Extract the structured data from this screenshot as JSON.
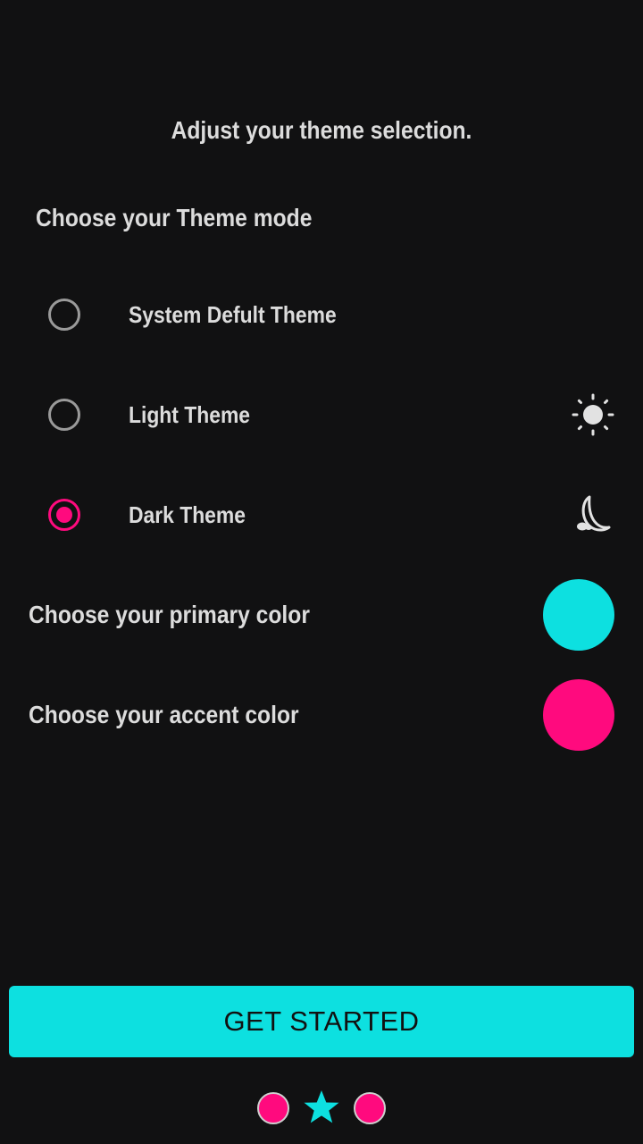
{
  "heading": "Adjust your theme selection.",
  "theme_section": {
    "label": "Choose your Theme mode",
    "options": [
      {
        "label": "System Defult Theme",
        "selected": false,
        "icon": ""
      },
      {
        "label": "Light Theme",
        "selected": false,
        "icon": "sun-icon"
      },
      {
        "label": "Dark Theme",
        "selected": true,
        "icon": "moon-icon"
      }
    ]
  },
  "colors": {
    "primary": {
      "label": "Choose your primary color",
      "value": "#0de0e0"
    },
    "accent": {
      "label": "Choose your accent color",
      "value": "#ff0a7e"
    }
  },
  "cta": {
    "label": "GET STARTED"
  },
  "page_indicator": {
    "total": 3,
    "current": 2
  }
}
